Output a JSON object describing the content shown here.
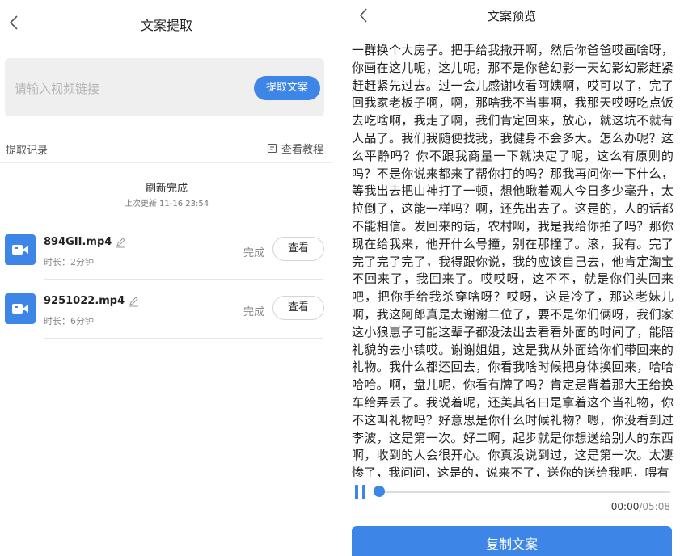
{
  "left": {
    "title": "文案提取",
    "input_placeholder": "请输入视频链接",
    "extract_button": "提取文案",
    "history_label": "提取记录",
    "tutorial_label": "查看教程",
    "refresh_title": "刷新完成",
    "refresh_sub": "上次更新 11-16 23:54",
    "files": [
      {
        "name": "894GII.mp4",
        "duration": "时长：2分钟",
        "status": "完成",
        "action": "查看"
      },
      {
        "name": "9251022.mp4",
        "duration": "时长：6分钟",
        "status": "完成",
        "action": "查看"
      }
    ],
    "icons": {
      "back": "back-arrow-icon",
      "edit": "pencil-edit-icon",
      "video": "video-camera-icon",
      "tutorial": "document-icon"
    },
    "accent": "#3d86e8"
  },
  "right": {
    "title": "文案预览",
    "transcript": "一群换个大房子。把手给我撒开啊，然后你爸爸哎画啥呀，你画在这儿呢，这儿呢，那不是你爸幻影一天幻影幻影赶紧赶赶紧先过去。过一会儿感谢收看阿姨啊，哎可以了，完了回我家老板子啊，啊，那啥我不当事啊，我那天哎呀吃点饭去吃啥啊，我走了啊，我们肯定回来，放心，就这坑不就有人品了。我们我随便找我，我健身不会多大。怎么办呢？这么平静吗？你不跟我商量一下就决定了呢，这么有原则的吗？不是你说来都来了帮你打的吗？那我再问你一下什么，等我出去把山神打了一顿，想他瞅着观人今日多少毫升，太拉倒了，这能一样吗？啊，还先出去了。这是的，人的话都不能相信。发回来的话，农村啊，我是我给你拍了吗？那你现在给我来，他开什么号撞，别在那撞了。滚，我有。完了完了完了完了，我得跟你说，我的应该自己去，他肯定淘宝不回来了，我回来了。哎哎呀，这不不，就是你们头回来吧，把你手给我杀穿啥呀？哎呀，这是冷了，那这老妹儿啊，我这阿郎真是太谢谢二位了，要不是你们俩呀，我们家这小狼崽子可能这辈子都没法出去看看外面的时间了，能陪礼貌的去小镇哎。谢谢姐姐，这是我从外面给你们带回来的礼物。我什么都还回去，你看我啥时候把身体换回来，哈哈哈哈。啊，盘儿呢，你看有牌了吗？肯定是背着那大王给换车给弄丢了。我说着呢，还美其名曰是拿着这个当礼物，你不这叫礼物吗？好意思是你什么时候礼物？嗯，你没看到过李波，这是第一次。好二啊，起步就是你想送给别人的东西啊，收到的人会很开心。你真没说到过，这是第一次。太凄惨了，我问问，这是的，说来不了，送你的送给我吧，喂有",
    "time_current": "00:00",
    "time_separator": "/",
    "time_total": "05:08",
    "progress": 0,
    "copy_button": "复制文案",
    "icons": {
      "back": "back-arrow-icon",
      "pause": "pause-icon"
    }
  }
}
